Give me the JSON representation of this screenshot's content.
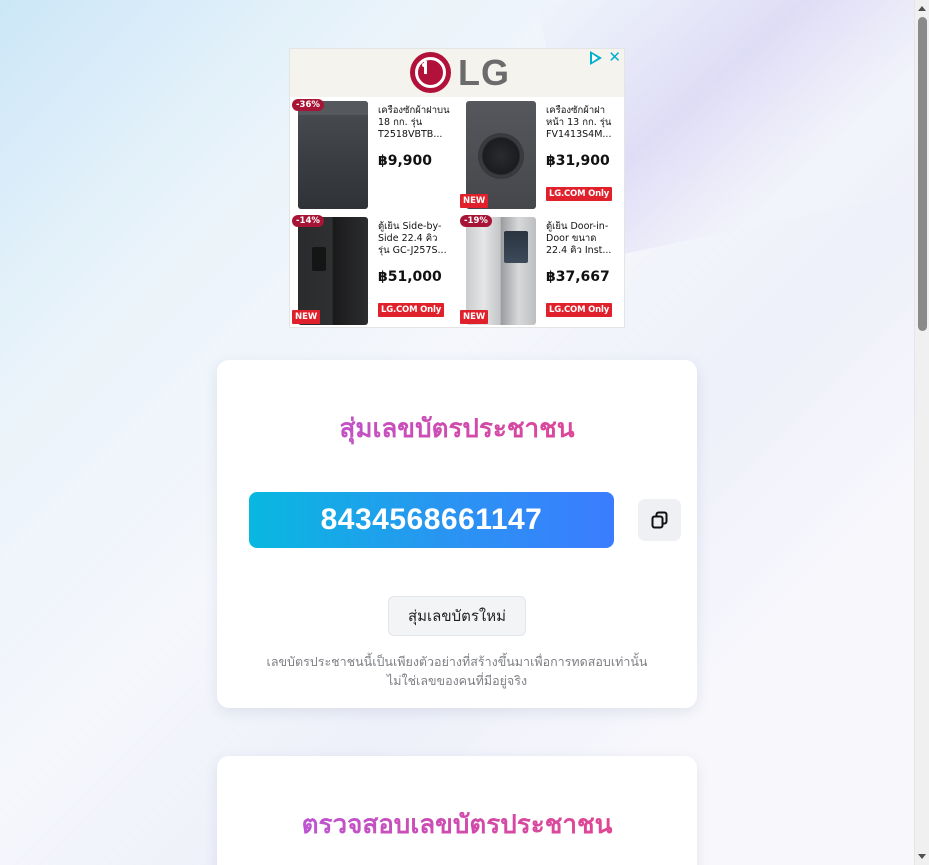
{
  "ad": {
    "brand": "LG",
    "products": [
      {
        "title": "เครื่องซักผ้าฝาบน 18 กก. รุ่น T2518VBTB...",
        "price": "฿9,900",
        "discount": "-36%",
        "new": "",
        "lg_only": ""
      },
      {
        "title": "เครื่องซักผ้าฝาหน้า 13 กก. รุ่น FV1413S4M...",
        "price": "฿31,900",
        "discount": "",
        "new": "NEW",
        "lg_only": "LG.COM Only"
      },
      {
        "title": "ตู้เย็น Side-by-Side 22.4 คิว รุ่น GC-J257S...",
        "price": "฿51,000",
        "discount": "-14%",
        "new": "NEW",
        "lg_only": "LG.COM Only"
      },
      {
        "title": "ตู้เย็น Door-in-Door ขนาด 22.4 คิว Inst...",
        "price": "฿37,667",
        "discount": "-19%",
        "new": "NEW",
        "lg_only": "LG.COM Only"
      }
    ]
  },
  "generator": {
    "title": "สุ่มเลขบัตรประชาชน",
    "id_number": "8434568661147",
    "random_button": "สุ่มเลขบัตรใหม่",
    "note_line1": "เลขบัตรประชาชนนี้เป็นเพียงตัวอย่างที่สร้างขึ้นมาเพื่อการทดสอบเท่านั้น",
    "note_line2": "ไม่ใช่เลขของคนที่มีอยู่จริง"
  },
  "validator": {
    "title": "ตรวจสอบเลขบัตรประชาชน"
  },
  "icons": {
    "copy": "copy-icon",
    "ad_choices": "adchoices-icon",
    "ad_close": "close-icon"
  }
}
